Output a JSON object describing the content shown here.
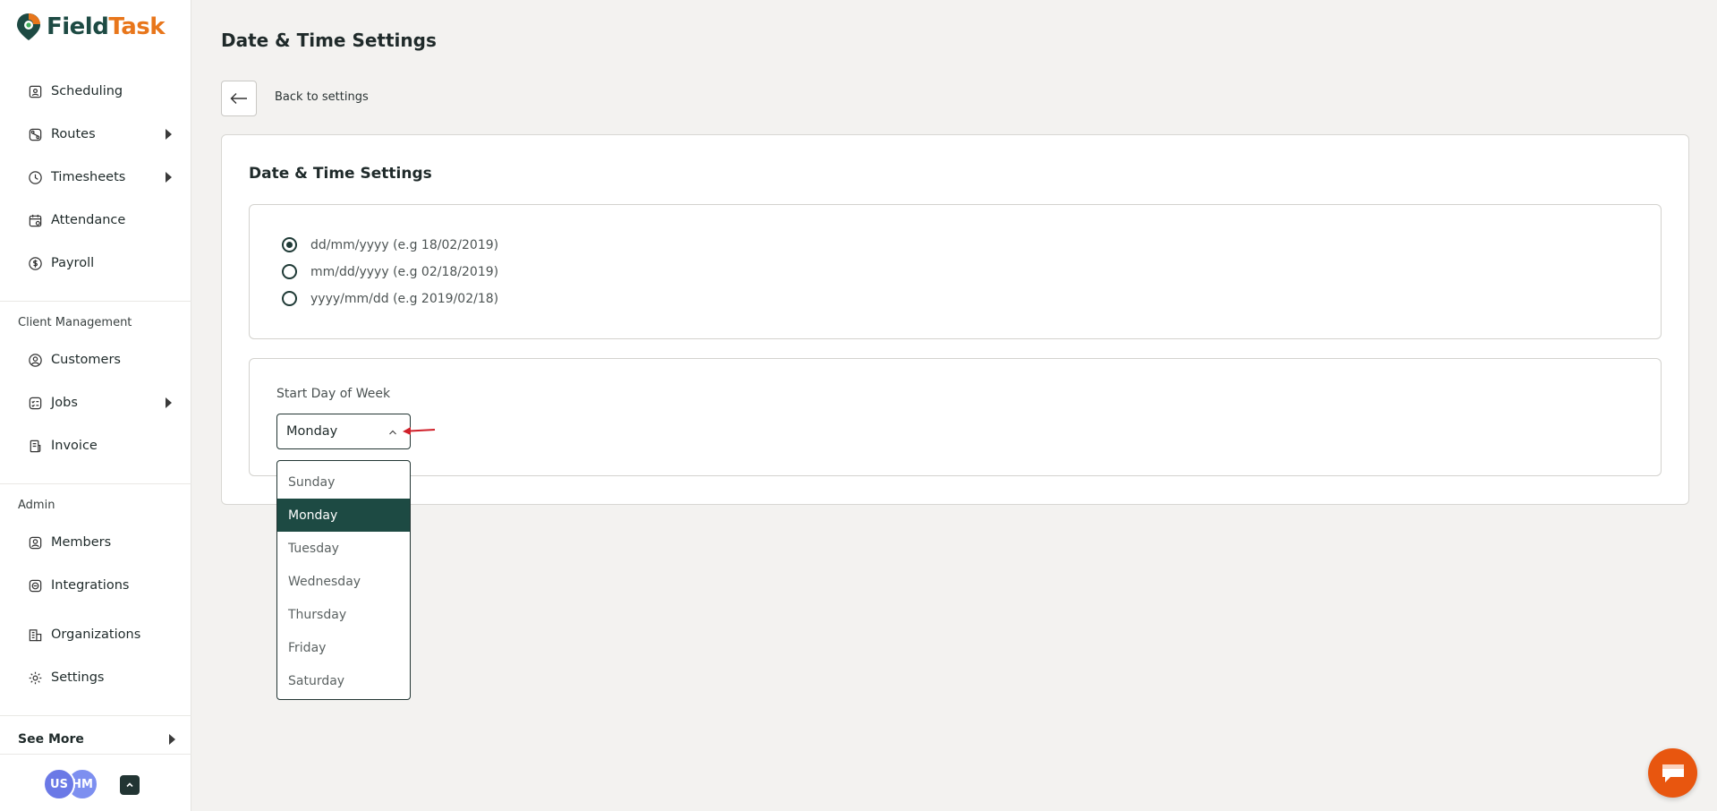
{
  "app": {
    "logo_part1": "Field",
    "logo_part2": "Task"
  },
  "sidebar": {
    "items": [
      {
        "label": "Scheduling",
        "icon": "calendar-user-icon"
      },
      {
        "label": "Routes",
        "icon": "route-icon",
        "expandable": true
      },
      {
        "label": "Timesheets",
        "icon": "clock-icon",
        "expandable": true
      },
      {
        "label": "Attendance",
        "icon": "calendar-check-icon"
      },
      {
        "label": "Payroll",
        "icon": "dollar-circle-icon"
      }
    ],
    "client_section": "Client Management",
    "client_items": [
      {
        "label": "Customers",
        "icon": "user-circle-icon"
      },
      {
        "label": "Jobs",
        "icon": "checklist-icon",
        "expandable": true
      },
      {
        "label": "Invoice",
        "icon": "invoice-icon"
      }
    ],
    "admin_section": "Admin",
    "admin_items": [
      {
        "label": "Members",
        "icon": "member-icon"
      },
      {
        "label": "Integrations",
        "icon": "integrations-icon"
      },
      {
        "label": "Organizations",
        "icon": "building-icon"
      },
      {
        "label": "Settings",
        "icon": "gear-icon"
      }
    ],
    "see_more": "See More",
    "avatars": [
      "US",
      "HM"
    ]
  },
  "header": {
    "title": "Date & Time Settings",
    "back_label": "Back to settings"
  },
  "card": {
    "title": "Date & Time Settings",
    "date_formats": [
      {
        "label": "dd/mm/yyyy (e.g 18/02/2019)",
        "selected": true
      },
      {
        "label": "mm/dd/yyyy (e.g 02/18/2019)",
        "selected": false
      },
      {
        "label": "yyyy/mm/dd (e.g 2019/02/18)",
        "selected": false
      }
    ],
    "start_day_label": "Start Day of Week",
    "start_day_value": "Monday",
    "start_day_options": [
      "Sunday",
      "Monday",
      "Tuesday",
      "Wednesday",
      "Thursday",
      "Friday",
      "Saturday"
    ]
  },
  "colors": {
    "brand_dark": "#1d4a43",
    "brand_orange": "#e8761b",
    "chat": "#e8560f",
    "annotation_arrow": "#d0202a"
  }
}
